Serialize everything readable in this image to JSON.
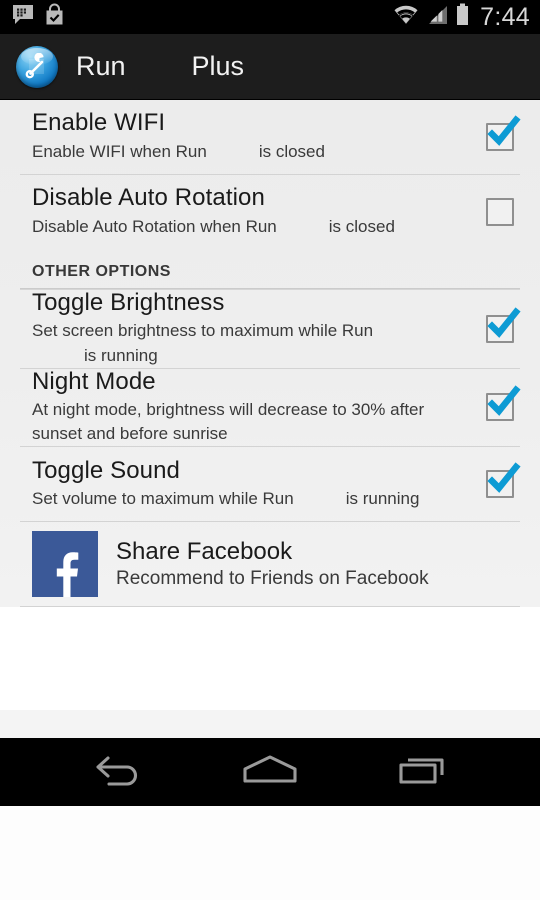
{
  "status_bar": {
    "icons_left": [
      "bbm-chat-icon",
      "play-store-bag-icon"
    ],
    "icons_right": [
      "wifi-icon",
      "cellular-signal-icon",
      "battery-icon"
    ],
    "clock": "7:44"
  },
  "action_bar": {
    "icon": "app-wrench-icon",
    "title": "Run",
    "title_suffix": "Plus"
  },
  "preferences": [
    {
      "title": "Enable WIFI",
      "summary_part1": "Enable WIFI when Run",
      "summary_part2": "is closed",
      "checked": true,
      "widget": "checkbox"
    },
    {
      "title": "Disable Auto Rotation",
      "summary_part1": "Disable Auto Rotation when Run",
      "summary_part2": "is closed",
      "checked": false,
      "widget": "checkbox"
    }
  ],
  "section": {
    "header": "OTHER OPTIONS",
    "items": [
      {
        "title": "Toggle Brightness",
        "summary_part1": "Set screen brightness to maximum while Run",
        "summary_part2": "is running",
        "checked": true,
        "widget": "checkbox"
      },
      {
        "title": "Night Mode",
        "summary_part1": "At night mode, brightness will decrease to 30% after sunset and before sunrise",
        "summary_part2": "",
        "checked": true,
        "widget": "checkbox"
      },
      {
        "title": "Toggle Sound",
        "summary_part1": "Set volume to maximum while Run",
        "summary_part2": "is running",
        "checked": true,
        "widget": "checkbox"
      }
    ]
  },
  "share": {
    "icon": "facebook-icon",
    "title": "Share Facebook",
    "summary": "Recommend to Friends on Facebook"
  },
  "nav_bar": {
    "back": "back-icon",
    "home": "home-icon",
    "recents": "recents-icon"
  },
  "colors": {
    "accent_blue": "#0d9bd4",
    "facebook_blue": "#3b5998",
    "action_bar_bg": "#1d1d1d",
    "status_bar_bg": "#000000",
    "list_bg": "#eeeeee",
    "divider": "#d3d3d3",
    "title_text": "#1a1a1a",
    "summary_text": "#3a3a3a"
  }
}
